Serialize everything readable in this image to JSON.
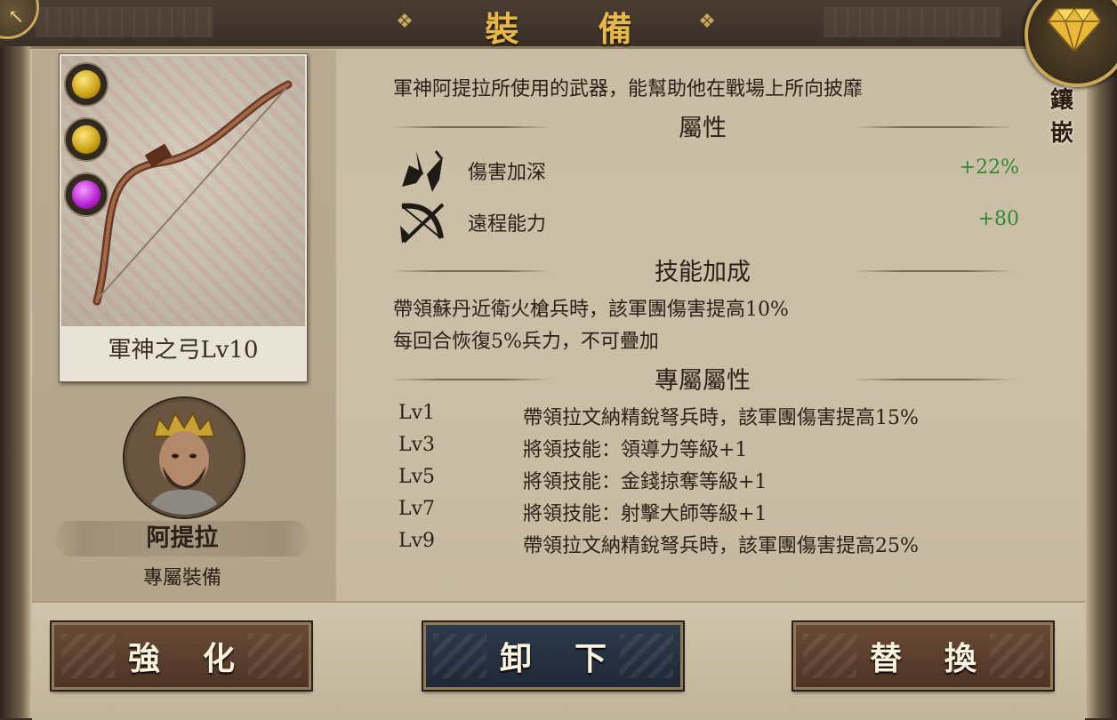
{
  "header": {
    "title": "裝 備"
  },
  "gem_button": {
    "label": "鑲嵌",
    "icon": "diamond-icon"
  },
  "item": {
    "name": "軍神之弓Lv10",
    "gems": [
      {
        "color": "#d8b41a"
      },
      {
        "color": "#d8b41a"
      },
      {
        "color": "#b51fd1"
      }
    ]
  },
  "hero": {
    "name": "阿提拉",
    "subtitle": "專屬裝備"
  },
  "description": "軍神阿提拉所使用的武器，能幫助他在戰場上所向披靡",
  "sections": {
    "attributes": "屬性",
    "skill_bonus": "技能加成",
    "exclusive": "專屬屬性"
  },
  "stats": [
    {
      "icon": "sword-damage-icon",
      "label": "傷害加深",
      "value": "+22%"
    },
    {
      "icon": "crossbow-icon",
      "label": "遠程能力",
      "value": "+80"
    }
  ],
  "skill_lines": [
    "帶領蘇丹近衛火槍兵時，該軍團傷害提高10%",
    "每回合恢復5%兵力，不可疊加"
  ],
  "exclusive_attrs": [
    {
      "level": "Lv1",
      "text": "帶領拉文納精銳弩兵時，該軍團傷害提高15%"
    },
    {
      "level": "Lv3",
      "text": "將領技能：領導力等級+1"
    },
    {
      "level": "Lv5",
      "text": "將領技能：金錢掠奪等級+1"
    },
    {
      "level": "Lv7",
      "text": "將領技能：射擊大師等級+1"
    },
    {
      "level": "Lv9",
      "text": "帶領拉文納精銳弩兵時，該軍團傷害提高25%"
    }
  ],
  "buttons": {
    "enhance": "強化",
    "unequip": "卸下",
    "replace": "替換"
  }
}
